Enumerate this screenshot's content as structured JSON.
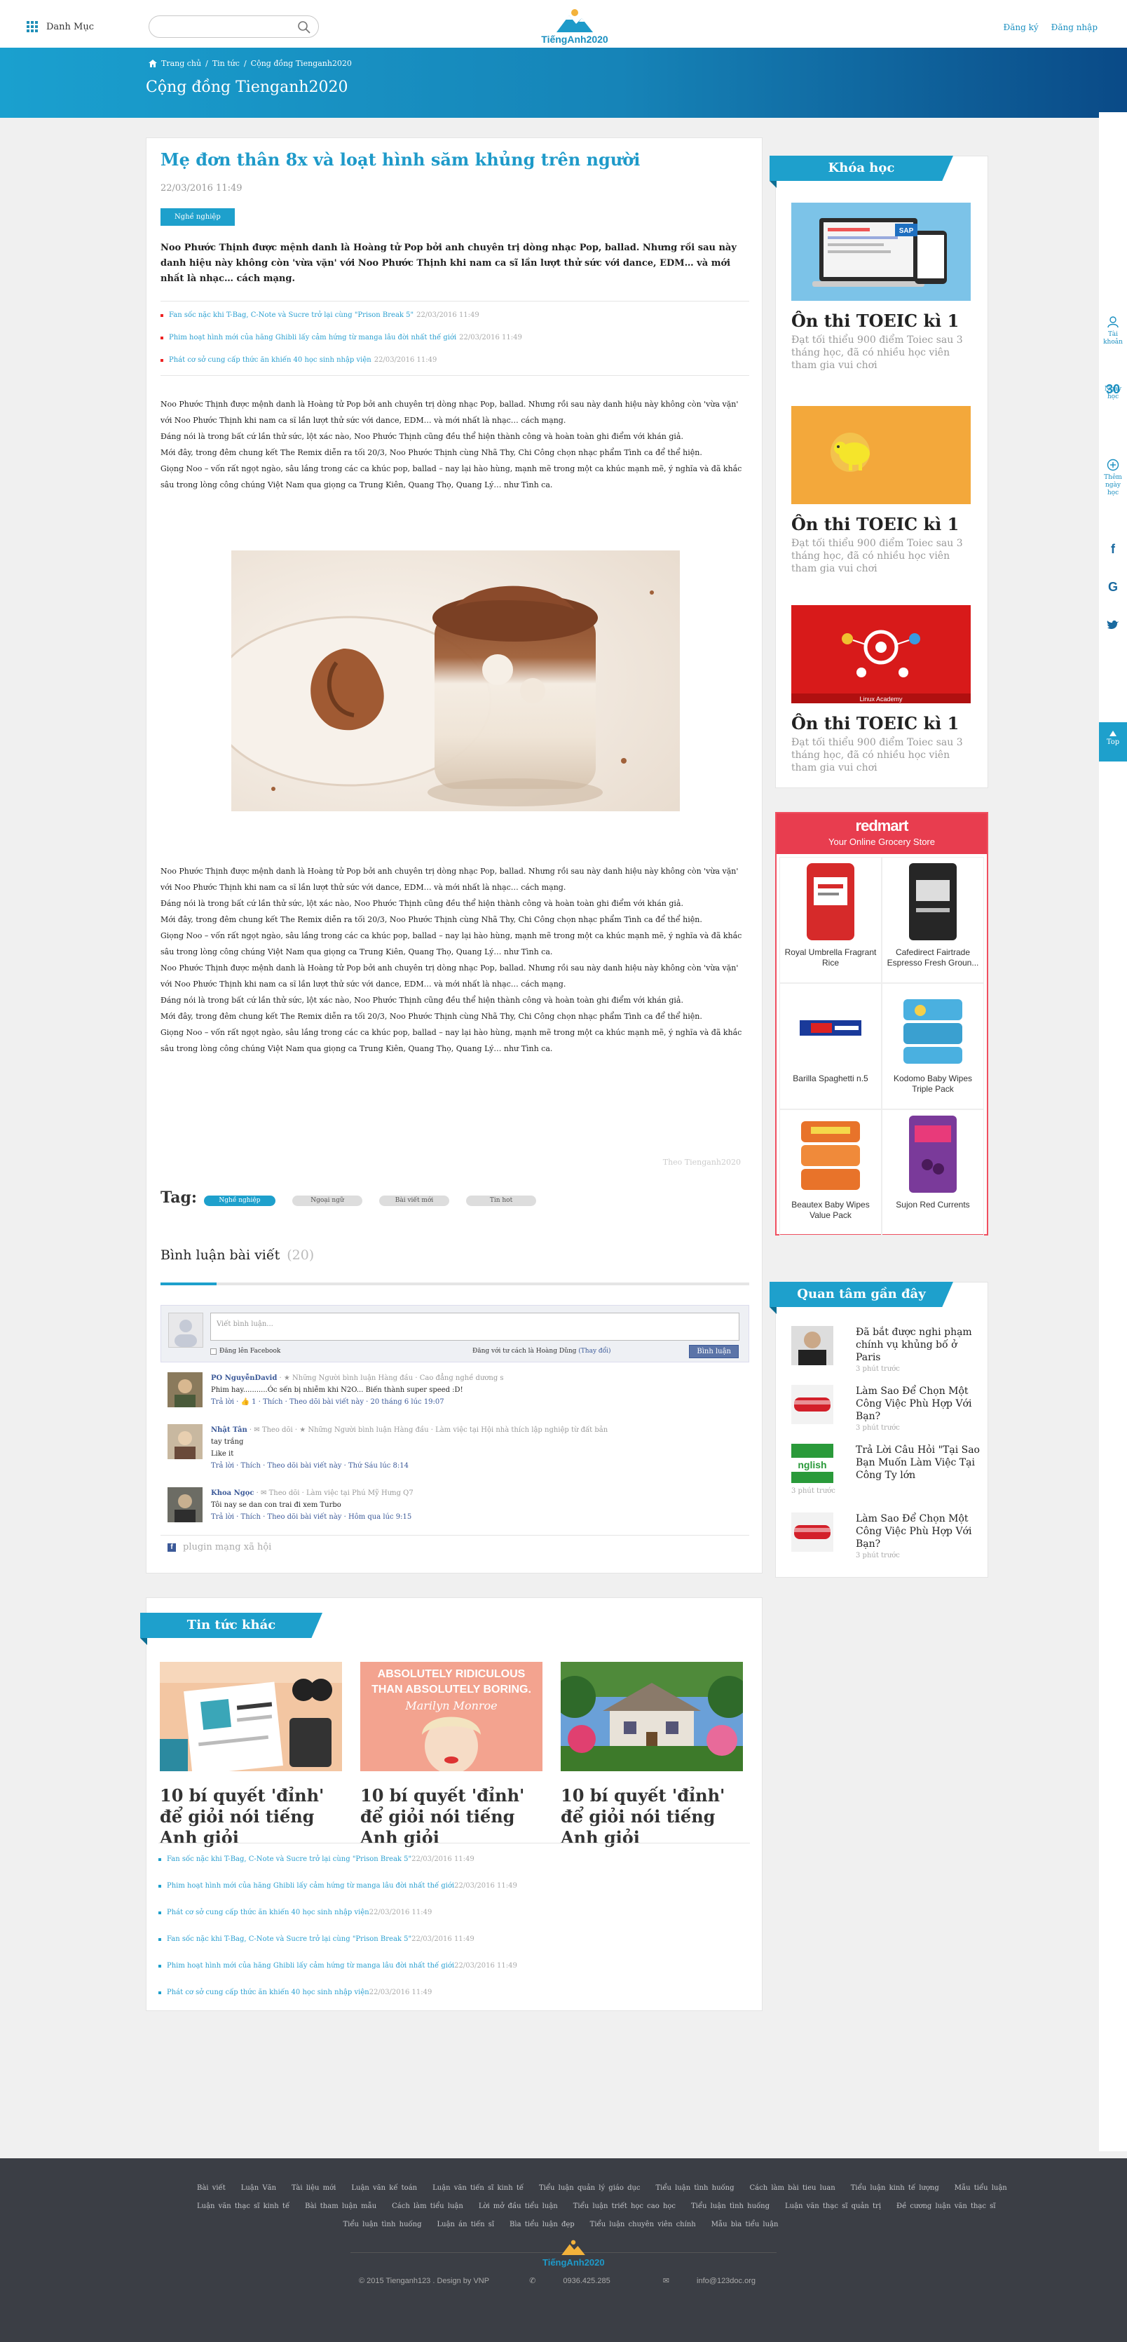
{
  "header": {
    "menu_label": "Danh Mục",
    "search_placeholder": "",
    "logo_text": "TiếngAnh2020",
    "register": "Đăng ký",
    "login": "Đăng nhập"
  },
  "banner": {
    "breadcrumb": [
      "Trang chủ",
      "Tin tức",
      "Cộng đồng Tienganh2020"
    ],
    "title": "Cộng đồng Tienganh2020"
  },
  "article": {
    "title": "Mẹ đơn thân 8x và loạt hình săm khủng trên người",
    "date": "22/03/2016 11:49",
    "category": "Nghề nghiệp",
    "lead": "Noo Phước Thịnh được mệnh danh là Hoàng tử Pop bởi anh chuyên trị dòng nhạc Pop, ballad. Nhưng rồi sau này danh hiệu này không còn 'vừa vặn' với Noo Phước Thịnh khi nam ca sĩ lần lượt thử sức với dance, EDM… và mới nhất là nhạc… cách mạng.",
    "related": [
      {
        "text": "Fan sốc nặc khi T-Bag, C-Note và Sucre trở lại cùng \"Prison Break 5\"",
        "date": "22/03/2016 11:49"
      },
      {
        "text": "Phim hoạt hình mới của hãng Ghibli lấy cảm hứng từ manga lâu đời nhất thế giới",
        "date": "22/03/2016 11:49"
      },
      {
        "text": "Phát cơ sở cung cấp thức ăn khiến 40 học sinh nhập viện",
        "date": "22/03/2016 11:49"
      }
    ],
    "body1": [
      "Noo Phước Thịnh được mệnh danh là Hoàng tử Pop bởi anh chuyên trị dòng nhạc Pop, ballad. Nhưng rồi sau này danh hiệu này không còn 'vừa vặn'",
      "với Noo Phước Thịnh khi nam ca sĩ lần lượt thử sức với dance, EDM… và mới nhất là nhạc… cách mạng.",
      "Đáng nói là trong bất cứ lần thử sức, lột xác nào, Noo Phước Thịnh cũng đều thể hiện thành công và hoàn toàn ghi điểm với khán giả.",
      "Mới đây, trong đêm chung kết The Remix diễn ra tối 20/3, Noo Phước Thịnh cùng Nhã Thy, Chi Công chọn nhạc phẩm Tình ca để thể hiện.",
      "Giọng Noo – vốn rất ngọt ngào, sâu lắng trong các ca khúc pop, ballad – nay lại hào hùng, mạnh mẽ trong một ca khúc mạnh mẽ, ý nghĩa và đã khắc",
      "sâu trong lòng công chúng Việt Nam qua giọng ca Trung Kiên, Quang Thọ, Quang Lý… như Tình ca."
    ],
    "body2": [
      "Noo Phước Thịnh được mệnh danh là Hoàng tử Pop bởi anh chuyên trị dòng nhạc Pop, ballad. Nhưng rồi sau này danh hiệu này không còn 'vừa vặn'",
      "với Noo Phước Thịnh khi nam ca sĩ lần lượt thử sức với dance, EDM… và mới nhất là nhạc… cách mạng.",
      "Đáng nói là trong bất cứ lần thử sức, lột xác nào, Noo Phước Thịnh cũng đều thể hiện thành công và hoàn toàn ghi điểm với khán giả.",
      "Mới đây, trong đêm chung kết The Remix diễn ra tối 20/3, Noo Phước Thịnh cùng Nhã Thy, Chi Công chọn nhạc phẩm Tình ca để thể hiện.",
      "Giọng Noo – vốn rất ngọt ngào, sâu lắng trong các ca khúc pop, ballad – nay lại hào hùng, mạnh mẽ trong một ca khúc mạnh mẽ, ý nghĩa và đã khắc",
      "sâu trong lòng công chúng Việt Nam qua giọng ca Trung Kiên, Quang Thọ, Quang Lý… như Tình ca.",
      "Noo Phước Thịnh được mệnh danh là Hoàng tử Pop bởi anh chuyên trị dòng nhạc Pop, ballad. Nhưng rồi sau này danh hiệu này không còn 'vừa vặn'",
      "với Noo Phước Thịnh khi nam ca sĩ lần lượt thử sức với dance, EDM… và mới nhất là nhạc… cách mạng.",
      "Đáng nói là trong bất cứ lần thử sức, lột xác nào, Noo Phước Thịnh cũng đều thể hiện thành công và hoàn toàn ghi điểm với khán giả.",
      "Mới đây, trong đêm chung kết The Remix diễn ra tối 20/3, Noo Phước Thịnh cùng Nhã Thy, Chi Công chọn nhạc phẩm Tình ca để thể hiện.",
      "Giọng Noo – vốn rất ngọt ngào, sâu lắng trong các ca khúc pop, ballad – nay lại hào hùng, mạnh mẽ trong một ca khúc mạnh mẽ, ý nghĩa và đã khắc",
      "sâu trong lòng công chúng Việt Nam qua giọng ca Trung Kiên, Quang Thọ, Quang Lý… như Tình ca."
    ],
    "credit": "Theo Tienganh2020",
    "tag_label": "Tag:",
    "tags": [
      "Nghề nghiệp",
      "Ngoại ngữ",
      "Bài viết mới",
      "Tin hot"
    ]
  },
  "comments": {
    "title": "Bình luận bài viết",
    "count": "(20)",
    "input_placeholder": "Viết bình luận...",
    "also_post": "Đăng lên Facebook",
    "posting_as": "Đăng với tư cách là Hoàng Dũng",
    "change": "(Thay đổi)",
    "post_button": "Bình luận",
    "items": [
      {
        "name": "PO NguyễnDavid",
        "meta": "· ★ Những Người bình luận Hàng đầu · Cao đẳng nghề dương s",
        "text": "Phim hay...........Óc sến bị nhiễm khi N2O... Biến thành super speed :D!",
        "actions": "Trả lời · 👍 1 · Thích · Theo dõi bài viết này · 20 tháng 6 lúc 19:07"
      },
      {
        "name": "Nhật Tân",
        "meta": "· ✉ Theo dõi · ★ Những Người bình luận Hàng đầu · Làm việc tại Hội nhà thích lập nghiệp từ đất bản",
        "text": "tay trắng",
        "text2": "Like it",
        "actions": "Trả lời · Thích · Theo dõi bài viết này · Thứ Sáu lúc 8:14"
      },
      {
        "name": "Khoa Ngọc",
        "meta": "· ✉ Theo dõi · Làm việc tại Phú Mỹ Hưng Q7",
        "text": "Tôi nay se dan con trai đi xem Turbo",
        "actions": "Trả lời · Thích · Theo dõi bài viết này · Hôm qua lúc 9:15"
      }
    ],
    "plugin": "plugin mạng xã hội"
  },
  "news": {
    "title": "Tin tức khác",
    "cards": [
      {
        "title": "10 bí quyết 'đỉnh' để giỏi nói tiếng Anh giỏi"
      },
      {
        "title": "10 bí quyết 'đỉnh' để giỏi nói tiếng Anh giỏi",
        "img_text1": "ABSOLUTELY RIDICULOUS",
        "img_text2": "THAN ABSOLUTELY BORING.",
        "img_text3": "Marilyn Monroe"
      },
      {
        "title": "10 bí quyết 'đỉnh' để giỏi nói tiếng Anh giỏi"
      }
    ],
    "list": [
      {
        "text": "Fan sốc nặc khi T-Bag, C-Note và Sucre trở lại cùng \"Prison Break 5\"",
        "date": "22/03/2016 11:49"
      },
      {
        "text": "Phim hoạt hình mới của hãng Ghibli lấy cảm hứng từ manga lâu đời nhất thế giới",
        "date": "22/03/2016 11:49"
      },
      {
        "text": "Phát cơ sở cung cấp thức ăn khiến 40 học sinh nhập viện",
        "date": "22/03/2016 11:49"
      },
      {
        "text": "Fan sốc nặc khi T-Bag, C-Note và Sucre trở lại cùng \"Prison Break 5\"",
        "date": "22/03/2016 11:49"
      },
      {
        "text": "Phim hoạt hình mới của hãng Ghibli lấy cảm hứng từ manga lâu đời nhất thế giới",
        "date": "22/03/2016 11:49"
      },
      {
        "text": "Phát cơ sở cung cấp thức ăn khiến 40 học sinh nhập viện",
        "date": "22/03/2016 11:49"
      }
    ]
  },
  "sidebar": {
    "courses_title": "Khóa học",
    "courses": [
      {
        "title": "Ôn thi TOEIC kì 1",
        "desc": "Đạt tối thiểu 900 điểm Toiec sau 3 tháng học, đã có nhiều học viên tham gia vui chơi",
        "img_text": "SAP"
      },
      {
        "title": "Ôn thi TOEIC kì 1",
        "desc": "Đạt tối thiểu 900 điểm Toiec sau 3 tháng học, đã có nhiều học viên tham gia vui chơi"
      },
      {
        "title": "Ôn thi TOEIC kì 1",
        "desc": "Đạt tối thiểu 900 điểm Toiec sau 3 tháng học, đã có nhiều học viên tham gia vui chơi",
        "img_text": "Linux Academy"
      }
    ],
    "ad": {
      "brand": "redmart",
      "tagline": "Your Online Grocery Store",
      "products": [
        "Royal Umbrella Fragrant Rice",
        "Cafedirect Fairtrade Espresso Fresh Groun...",
        "Barilla Spaghetti n.5",
        "Kodomo Baby Wipes Triple Pack",
        "Beautex Baby Wipes Value Pack",
        "Sujon Red Currents"
      ]
    },
    "recent_title": "Quan tâm gần đây",
    "recent": [
      {
        "title": "Đã bắt được nghi phạm chính vụ khủng bố ở Paris",
        "time": "3 phút trước"
      },
      {
        "title": "Làm Sao Để Chọn Một Công Việc Phù Hợp Với Bạn?",
        "time": "3 phút trước"
      },
      {
        "title": "Trả Lời Câu Hỏi \"Tại Sao Bạn Muốn Làm Việc Tại Công Ty lớn",
        "time": "3 phút trước",
        "img_text": "nglish"
      },
      {
        "title": "Làm Sao Để Chọn Một Công Việc Phù Hợp Với Bạn?",
        "time": "3 phút trước"
      }
    ]
  },
  "rail": {
    "account": "Tài khoản",
    "streak_num": "30",
    "streak_label": "Ngày học",
    "add_label": "Thêm ngày học",
    "top": "Top"
  },
  "footer": {
    "links": [
      "Bài viết",
      "Luận Văn",
      "Tài liệu mới",
      "Luận văn kế toán",
      "Luận văn tiến sĩ kinh tế",
      "Tiểu luận quản lý giáo dục",
      "Tiểu luận tình huống",
      "Cách làm bài tieu luan",
      "Tiểu luận kinh tế lượng",
      "Mẫu tiểu luận",
      "Luận văn thạc sĩ kinh tế",
      "Bài tham luận mẫu",
      "Cách làm tiểu luận",
      "Lời mở đầu tiểu luận",
      "Tiểu luận triết học cao học",
      "Tiểu luận tình huống",
      "Luận văn thạc sĩ quản trị",
      "Đề cương luận văn thạc sĩ",
      "Tiểu luận tình huống",
      "Luận án tiến sĩ",
      "Bìa tiểu luận đẹp",
      "Tiểu luận chuyên viên chính",
      "Mẫu bìa tiểu luận"
    ],
    "logo_text": "TiếngAnh2020",
    "copyright": "© 2015 Tienganh123 . Design by VNP",
    "phone": "0936.425.285",
    "email": "info@123doc.org"
  }
}
